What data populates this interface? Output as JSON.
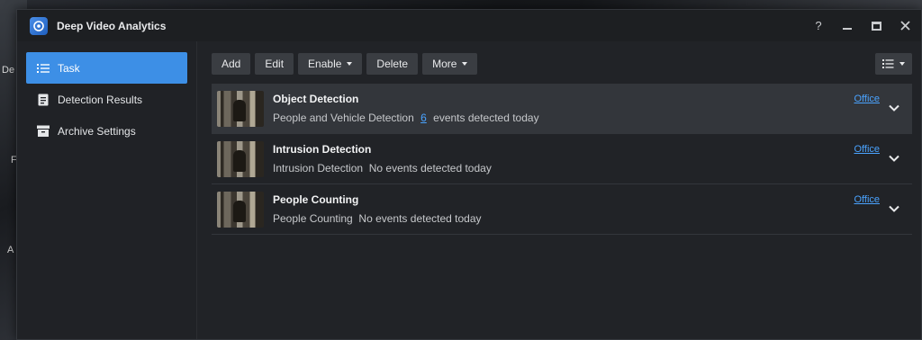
{
  "desktop": {
    "labels": [
      "De",
      "F",
      "A"
    ]
  },
  "window": {
    "title": "Deep Video Analytics",
    "controls": {
      "help": "?"
    }
  },
  "sidebar": {
    "items": [
      {
        "label": "Task",
        "icon": "list-icon",
        "active": true
      },
      {
        "label": "Detection Results",
        "icon": "document-icon",
        "active": false
      },
      {
        "label": "Archive Settings",
        "icon": "archive-icon",
        "active": false
      }
    ]
  },
  "toolbar": {
    "add_label": "Add",
    "edit_label": "Edit",
    "enable_label": "Enable",
    "delete_label": "Delete",
    "more_label": "More"
  },
  "tasks": [
    {
      "title": "Object Detection",
      "type": "People and Vehicle Detection",
      "count": "6",
      "status_suffix": "events detected today",
      "location": "Office",
      "selected": true
    },
    {
      "title": "Intrusion Detection",
      "type": "Intrusion Detection",
      "status": "No events detected today",
      "location": "Office",
      "selected": false
    },
    {
      "title": "People Counting",
      "type": "People Counting",
      "status": "No events detected today",
      "location": "Office",
      "selected": false
    }
  ],
  "colors": {
    "accent": "#3d8fe6",
    "link": "#4aa3ff",
    "window_bg": "#212327"
  }
}
